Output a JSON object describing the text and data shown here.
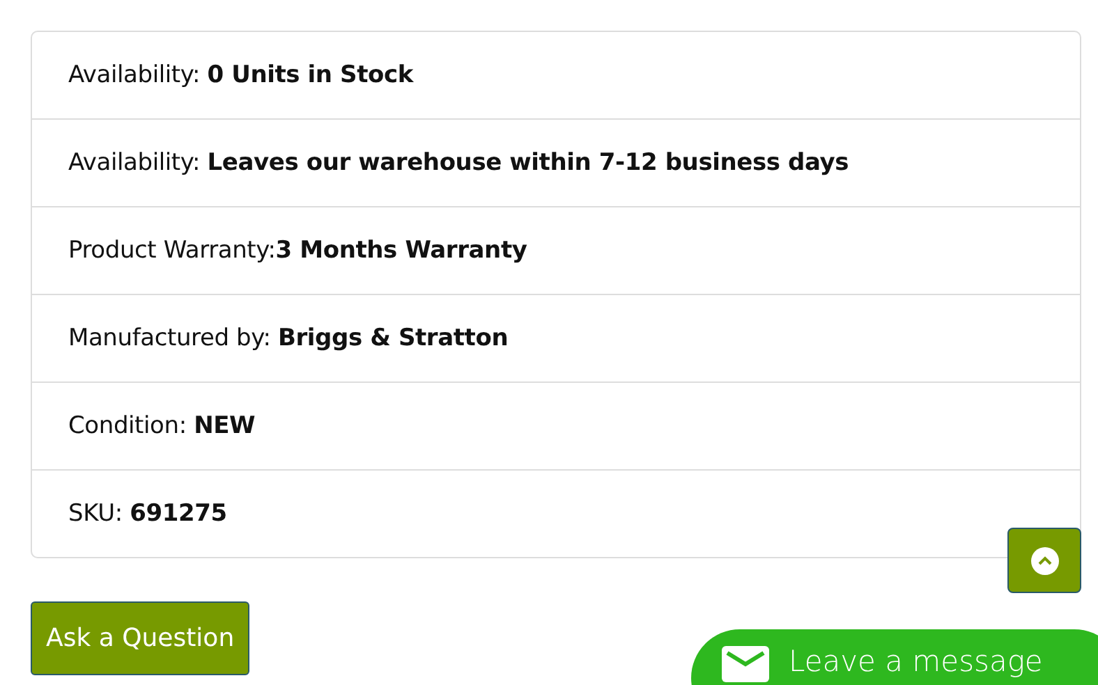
{
  "details": [
    {
      "label": "Availability: ",
      "value": "0 Units in Stock"
    },
    {
      "label": "Availability: ",
      "value": "Leaves our warehouse within 7-12 business days"
    },
    {
      "label": "Product Warranty:",
      "value": "3 Months Warranty"
    },
    {
      "label": "Manufactured by: ",
      "value": "Briggs & Stratton"
    },
    {
      "label": "Condition: ",
      "value": "NEW"
    },
    {
      "label": "SKU: ",
      "value": "691275"
    }
  ],
  "ask_button": "Ask a Question",
  "chat_button": "Leave a message"
}
